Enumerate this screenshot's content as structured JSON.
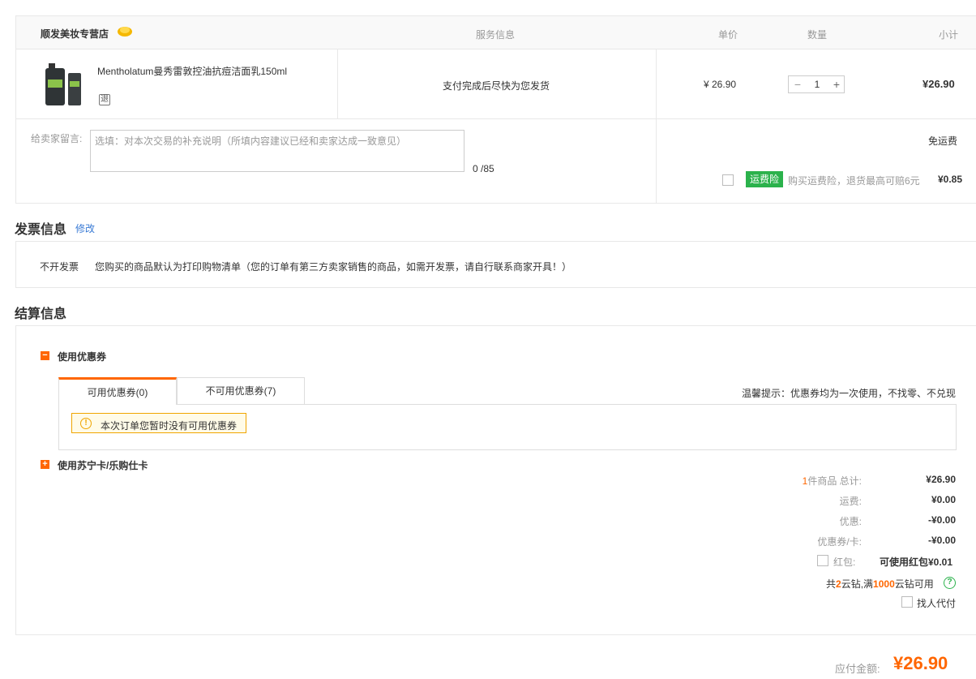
{
  "order": {
    "store_name": "顺发美妆专营店",
    "columns": {
      "service": "服务信息",
      "unit_price": "单价",
      "quantity": "数量",
      "subtotal": "小计"
    },
    "product": {
      "title": "Mentholatum曼秀雷敦控油抗痘洁面乳150ml",
      "tag_icon_glyph": "退",
      "service_text": "支付完成后尽快为您发货",
      "unit_price": "¥ 26.90",
      "quantity": "1",
      "subtotal": "¥26.90"
    },
    "message": {
      "label": "给卖家留言:",
      "placeholder": "选填：对本次交易的补充说明（所填内容建议已经和卖家达成一致意见）",
      "value": "",
      "count": "0 /85"
    },
    "shipping": {
      "fee_text": "免运费",
      "insurance_badge": "运费险",
      "insurance_desc": "购买运费险，退货最高可赔6元",
      "insurance_price": "¥0.85"
    }
  },
  "invoice": {
    "title": "发票信息",
    "edit_label": "修改",
    "type": "不开发票",
    "desc": "您购买的商品默认为打印购物清单（您的订单有第三方卖家销售的商品，如需开发票，请自行联系商家开具！）"
  },
  "settlement": {
    "title": "结算信息",
    "coupon": {
      "label": "使用优惠券",
      "toggle_glyph": "−",
      "tab_available": "可用优惠券(0)",
      "tab_unavailable": "不可用优惠券(7)",
      "tip": "温馨提示：优惠券均为一次使用，不找零、不兑现",
      "empty_text": "本次订单您暂时没有可用优惠券",
      "warn_glyph": "!"
    },
    "card": {
      "label": "使用苏宁卡/乐购仕卡",
      "toggle_glyph": "+"
    },
    "summary": {
      "count_num": "1",
      "count_label": "件商品 总计:",
      "count_val": "¥26.90",
      "ship_label": "运费:",
      "ship_val": "¥0.00",
      "disc_label": "优惠:",
      "disc_val": "-¥0.00",
      "coupon_label": "优惠券/卡:",
      "coupon_val": "-¥0.00",
      "redpack_label": "红包:",
      "redpack_val": "可使用红包¥0.01",
      "diamond_pre": "共",
      "diamond_num": "2",
      "diamond_mid": "云钻,满",
      "diamond_threshold": "1000",
      "diamond_post": "云钻可用",
      "help_glyph": "?",
      "payfor_label": "找人代付"
    }
  },
  "total": {
    "label": "应付金额:",
    "value": "¥26.90"
  },
  "colors": {
    "accent": "#ff6600",
    "insurance_green": "#2bb24c",
    "link_blue": "#3a7bd5"
  }
}
